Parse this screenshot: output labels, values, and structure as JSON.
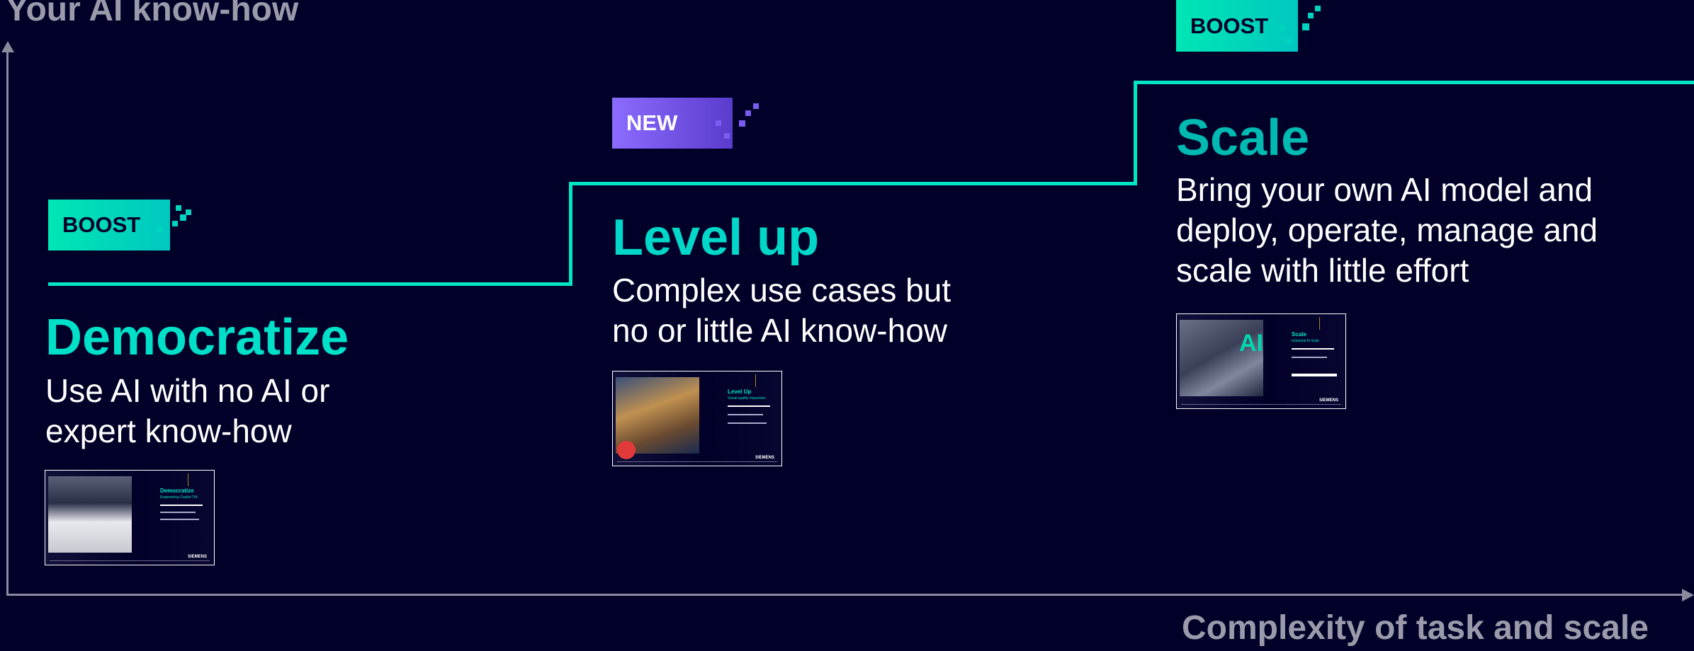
{
  "axes": {
    "y_label": "Your AI know-how",
    "x_label": "Complexity of task and scale"
  },
  "colors": {
    "background": "#000028",
    "accent": "#00e6c4",
    "heading": "#00d7c8",
    "axis": "#8a8a9e",
    "new_badge": "#7a5cf0"
  },
  "steps": [
    {
      "badge": "BOOST",
      "title": "Democratize",
      "description": [
        "Use AI with no AI or",
        "expert know-how"
      ],
      "thumbnail": {
        "title": "Democratize",
        "subtitle": "Engineering Copilot TIA",
        "brand": "SIEMENS"
      }
    },
    {
      "badge": "NEW",
      "title": "Level up",
      "description": [
        "Complex use cases but",
        "no or little AI know-how"
      ],
      "thumbnail": {
        "title": "Level Up",
        "subtitle": "Visual quality inspection",
        "brand": "SIEMENS"
      }
    },
    {
      "badge": "BOOST",
      "title": "Scale",
      "description": [
        "Bring your own AI model and",
        "deploy, operate, manage and",
        "scale with little effort"
      ],
      "thumbnail": {
        "title": "Scale",
        "subtitle": "Industrial AI Suite",
        "overlay": "AI",
        "brand": "SIEMENS"
      }
    }
  ]
}
